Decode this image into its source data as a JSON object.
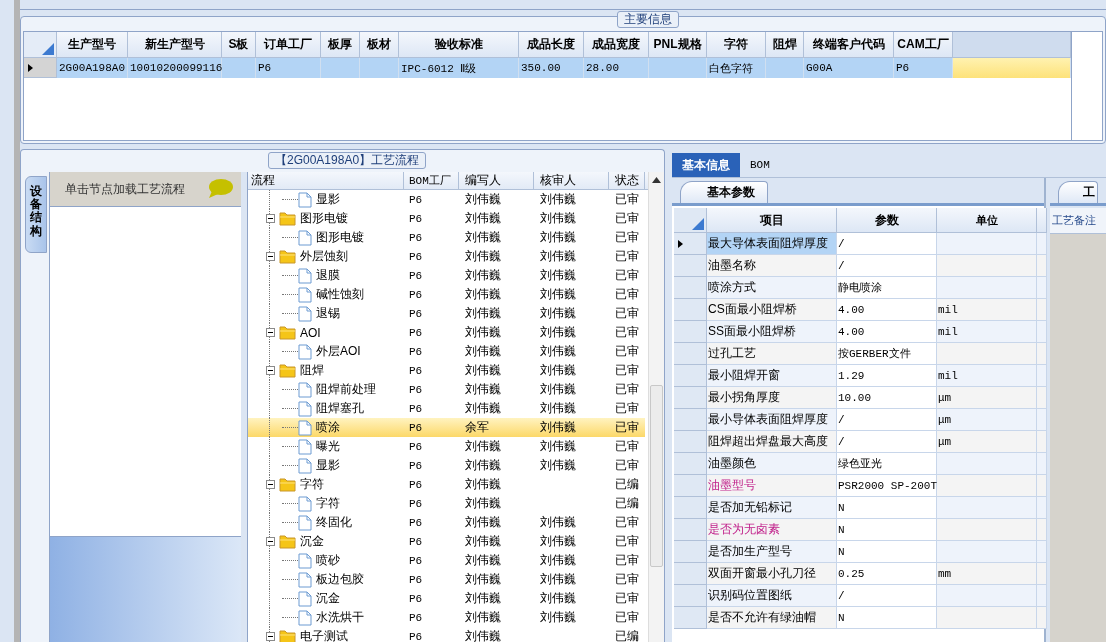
{
  "main_info": {
    "title": "主要信息",
    "columns": [
      "生产型号",
      "新生产型号",
      "S板",
      "订单工厂",
      "板厚",
      "板材",
      "验收标准",
      "成品长度",
      "成品宽度",
      "PNL规格",
      "字符",
      "阻焊",
      "终端客户代码",
      "CAM工厂"
    ],
    "rows": [
      {
        "selected": true,
        "cells": [
          "2G00A198A0",
          "10010200099116",
          "",
          "P6",
          "",
          "",
          "IPC-6012 Ⅱ级",
          "350.00",
          "28.00",
          "",
          "白色字符",
          "",
          "G00A",
          "P6"
        ]
      }
    ]
  },
  "flow": {
    "title": "【2G00A198A0】工艺流程",
    "side_tab": "设备结构",
    "hint": "单击节点加载工艺流程",
    "columns": [
      "流程",
      "BOM工厂",
      "编写人",
      "核审人",
      "状态"
    ],
    "nodes": [
      {
        "kind": "file",
        "label": "显影",
        "bom": "P6",
        "writer": "刘伟巍",
        "reviewer": "刘伟巍",
        "status": "已审",
        "selected": false
      },
      {
        "kind": "folder",
        "expanded": true,
        "label": "图形电镀",
        "bom": "P6",
        "writer": "刘伟巍",
        "reviewer": "刘伟巍",
        "status": "已审",
        "selected": false,
        "children": [
          {
            "kind": "file",
            "label": "图形电镀",
            "bom": "P6",
            "writer": "刘伟巍",
            "reviewer": "刘伟巍",
            "status": "已审",
            "selected": false
          }
        ]
      },
      {
        "kind": "folder",
        "expanded": true,
        "label": "外层蚀刻",
        "bom": "P6",
        "writer": "刘伟巍",
        "reviewer": "刘伟巍",
        "status": "已审",
        "selected": false,
        "children": [
          {
            "kind": "file",
            "label": "退膜",
            "bom": "P6",
            "writer": "刘伟巍",
            "reviewer": "刘伟巍",
            "status": "已审",
            "selected": false
          },
          {
            "kind": "file",
            "label": "碱性蚀刻",
            "bom": "P6",
            "writer": "刘伟巍",
            "reviewer": "刘伟巍",
            "status": "已审",
            "selected": false
          },
          {
            "kind": "file",
            "label": "退锡",
            "bom": "P6",
            "writer": "刘伟巍",
            "reviewer": "刘伟巍",
            "status": "已审",
            "selected": false
          }
        ]
      },
      {
        "kind": "folder",
        "expanded": true,
        "label": "AOI",
        "bom": "P6",
        "writer": "刘伟巍",
        "reviewer": "刘伟巍",
        "status": "已审",
        "selected": false,
        "children": [
          {
            "kind": "file",
            "label": "外层AOI",
            "bom": "P6",
            "writer": "刘伟巍",
            "reviewer": "刘伟巍",
            "status": "已审",
            "selected": false
          }
        ]
      },
      {
        "kind": "folder",
        "expanded": true,
        "label": "阻焊",
        "bom": "P6",
        "writer": "刘伟巍",
        "reviewer": "刘伟巍",
        "status": "已审",
        "selected": false,
        "children": [
          {
            "kind": "file",
            "label": "阻焊前处理",
            "bom": "P6",
            "writer": "刘伟巍",
            "reviewer": "刘伟巍",
            "status": "已审",
            "selected": false
          },
          {
            "kind": "file",
            "label": "阻焊塞孔",
            "bom": "P6",
            "writer": "刘伟巍",
            "reviewer": "刘伟巍",
            "status": "已审",
            "selected": false
          },
          {
            "kind": "file",
            "label": "喷涂",
            "bom": "P6",
            "writer": "余军",
            "reviewer": "刘伟巍",
            "status": "已审",
            "selected": true
          },
          {
            "kind": "file",
            "label": "曝光",
            "bom": "P6",
            "writer": "刘伟巍",
            "reviewer": "刘伟巍",
            "status": "已审",
            "selected": false
          },
          {
            "kind": "file",
            "label": "显影",
            "bom": "P6",
            "writer": "刘伟巍",
            "reviewer": "刘伟巍",
            "status": "已审",
            "selected": false
          }
        ]
      },
      {
        "kind": "folder",
        "expanded": true,
        "label": "字符",
        "bom": "P6",
        "writer": "刘伟巍",
        "status": "已编",
        "selected": false,
        "children": [
          {
            "kind": "file",
            "label": "字符",
            "bom": "P6",
            "writer": "刘伟巍",
            "status": "已编",
            "selected": false
          },
          {
            "kind": "file",
            "label": "终固化",
            "bom": "P6",
            "writer": "刘伟巍",
            "reviewer": "刘伟巍",
            "status": "已审",
            "selected": false
          }
        ]
      },
      {
        "kind": "folder",
        "expanded": true,
        "label": "沉金",
        "bom": "P6",
        "writer": "刘伟巍",
        "reviewer": "刘伟巍",
        "status": "已审",
        "selected": false,
        "children": [
          {
            "kind": "file",
            "label": "喷砂",
            "bom": "P6",
            "writer": "刘伟巍",
            "reviewer": "刘伟巍",
            "status": "已审",
            "selected": false
          },
          {
            "kind": "file",
            "label": "板边包胶",
            "bom": "P6",
            "writer": "刘伟巍",
            "reviewer": "刘伟巍",
            "status": "已审",
            "selected": false
          },
          {
            "kind": "file",
            "label": "沉金",
            "bom": "P6",
            "writer": "刘伟巍",
            "reviewer": "刘伟巍",
            "status": "已审",
            "selected": false
          },
          {
            "kind": "file",
            "label": "水洗烘干",
            "bom": "P6",
            "writer": "刘伟巍",
            "reviewer": "刘伟巍",
            "status": "已审",
            "selected": false
          }
        ]
      },
      {
        "kind": "folder",
        "expanded": true,
        "label": "电子测试",
        "bom": "P6",
        "writer": "刘伟巍",
        "status": "已编",
        "selected": false
      }
    ]
  },
  "info_tabs": [
    {
      "label": "基本信息",
      "selected": true
    },
    {
      "label": "BOM",
      "selected": false
    }
  ],
  "params": {
    "tab": "基本参数",
    "columns": [
      "项目",
      "参数",
      "单位"
    ],
    "rows": [
      {
        "item": "最大导体表面阻焊厚度",
        "value": "/",
        "selected": true,
        "highlighted": false
      },
      {
        "item": "油墨名称",
        "value": "/",
        "selected": false,
        "highlighted": false
      },
      {
        "item": "喷涂方式",
        "value": "静电喷涂",
        "selected": false,
        "highlighted": false
      },
      {
        "item": "CS面最小阻焊桥",
        "value": "4.00",
        "unit": "mil",
        "selected": false,
        "highlighted": false
      },
      {
        "item": "SS面最小阻焊桥",
        "value": "4.00",
        "unit": "mil",
        "selected": false,
        "highlighted": false
      },
      {
        "item": "过孔工艺",
        "value": "按GERBER文件",
        "selected": false,
        "highlighted": false
      },
      {
        "item": "最小阻焊开窗",
        "value": "1.29",
        "unit": "mil",
        "selected": false,
        "highlighted": false
      },
      {
        "item": "最小拐角厚度",
        "value": "10.00",
        "unit": "μm",
        "selected": false,
        "highlighted": false
      },
      {
        "item": "最小导体表面阻焊厚度",
        "value": "/",
        "unit": "μm",
        "selected": false,
        "highlighted": false
      },
      {
        "item": "阻焊超出焊盘最大高度",
        "value": "/",
        "unit": "μm",
        "selected": false,
        "highlighted": false
      },
      {
        "item": "油墨颜色",
        "value": "绿色亚光",
        "selected": false,
        "highlighted": false
      },
      {
        "item": "油墨型号",
        "value": "PSR2000 SP-200T",
        "selected": false,
        "highlighted": true
      },
      {
        "item": "是否加无铅标记",
        "value": "N",
        "selected": false,
        "highlighted": false
      },
      {
        "item": "是否为无卤素",
        "value": "N",
        "selected": false,
        "highlighted": true
      },
      {
        "item": "是否加生产型号",
        "value": "N",
        "selected": false,
        "highlighted": false
      },
      {
        "item": "双面开窗最小孔刀径",
        "value": "0.25",
        "unit": "mm",
        "selected": false,
        "highlighted": false
      },
      {
        "item": "识别码位置图纸",
        "value": "/",
        "selected": false,
        "highlighted": false
      },
      {
        "item": "是否不允许有绿油帽",
        "value": "N",
        "selected": false,
        "highlighted": false
      }
    ]
  },
  "remarks": {
    "tab": "工",
    "column": "工艺备注"
  }
}
